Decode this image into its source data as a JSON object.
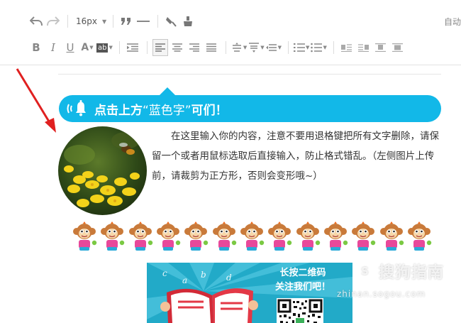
{
  "toolbar": {
    "font_size": "16px",
    "autosave_label": "自动",
    "row1_icons": [
      "undo-icon",
      "redo-icon",
      "blockquote-icon",
      "horizontal-rule-icon",
      "format-brush-icon",
      "clear-format-icon"
    ],
    "row2_icons": [
      "bold-icon",
      "italic-icon",
      "underline-icon",
      "font-color-icon",
      "background-color-icon",
      "indent-icon",
      "align-left-icon",
      "align-center-icon",
      "align-right-icon",
      "align-justify-icon",
      "line-height-icon",
      "paragraph-spacing-icon",
      "letter-spacing-icon",
      "ordered-list-icon",
      "unordered-list-icon",
      "image-float-left-icon",
      "image-float-right-icon",
      "image-center-icon",
      "image-none-icon"
    ],
    "labels": {
      "bold": "B",
      "italic": "I",
      "underline": "U",
      "font_color": "A",
      "background_color": "ab"
    }
  },
  "editor": {
    "banner": {
      "text_before": "点击上方",
      "text_highlight": "“蓝色字”",
      "text_after": "可们！",
      "color": "#12b8e8"
    },
    "body_paragraph": "在这里输入你的内容，注意不要用退格键把所有文字删除，请保留一个或者用鼠标选取后直接输入，防止格式错乱。（左侧图片上传前，请裁剪为正方形，否则会变形哦~）",
    "monkey_count": 13,
    "qr_card": {
      "title_line1": "长按二维码",
      "title_line2": "关注我们吧！",
      "letters": [
        "c",
        "a",
        "b",
        "d"
      ]
    }
  },
  "watermark": {
    "brand": "搜狗指南",
    "url": "zhinan.sogou.com"
  },
  "colors": {
    "accent_blue": "#12b8e8",
    "arrow_red": "#e02020"
  }
}
